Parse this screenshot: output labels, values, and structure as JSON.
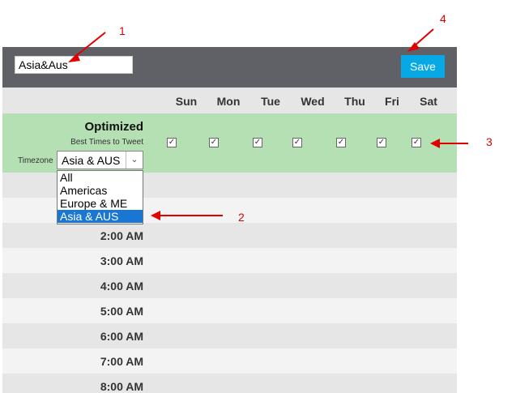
{
  "header": {
    "name_value": "Asia&Aus",
    "save_label": "Save"
  },
  "days": [
    "Sun",
    "Mon",
    "Tue",
    "Wed",
    "Thu",
    "Fri",
    "Sat"
  ],
  "optimized": {
    "title": "Optimized",
    "best_times_label": "Best Times to Tweet",
    "timezone_label": "Timezone",
    "timezone_value": "Asia & AUS",
    "checkboxes_checked": [
      true,
      true,
      true,
      true,
      true,
      true,
      true
    ]
  },
  "timezone_dropdown": {
    "options": [
      "All",
      "Americas",
      "Europe & ME",
      "Asia & AUS"
    ],
    "selected": "Asia & AUS"
  },
  "times": [
    "2:00 AM",
    "3:00 AM",
    "4:00 AM",
    "5:00 AM",
    "6:00 AM",
    "7:00 AM",
    "8:00 AM"
  ],
  "annotations": {
    "n1": "1",
    "n2": "2",
    "n3": "3",
    "n4": "4",
    "color": "#e00000"
  },
  "colors": {
    "header_bg": "#5f6166",
    "save_bg": "#06a9e6",
    "optimized_bg": "#b5e0b4",
    "selected_option": "#1976d2"
  }
}
